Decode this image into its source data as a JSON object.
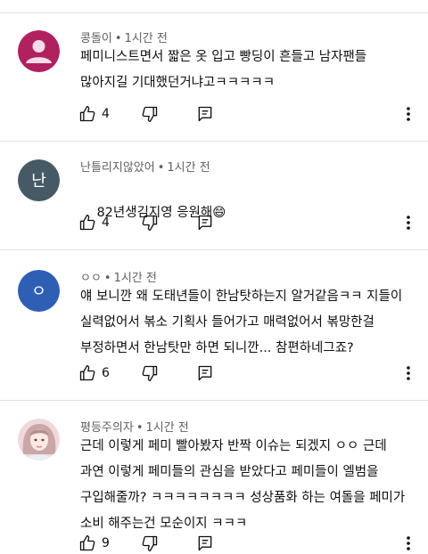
{
  "comments": [
    {
      "author": "콩돌이",
      "time": "1시간 전",
      "text": "페미니스트면서 짧은 옷 입고 빵딩이 흔들고 남자팬들 많아지길 기대했던거냐고ㅋㅋㅋㅋㅋ",
      "likes": "4",
      "avatar": {
        "kind": "default-person",
        "color": "#b1205f"
      }
    },
    {
      "author": "난틀리지않았어",
      "time": "1시간 전",
      "text": "82년생김지영 응원해",
      "emoji": "😄",
      "likes": "4",
      "avatar": {
        "kind": "letter",
        "letter": "난",
        "color": "#455a64"
      }
    },
    {
      "author": "ㅇㅇ",
      "time": "1시간 전",
      "text": "얘 보니깐 왜 도태년들이 한남탓하는지 알거같음ㅋㅋ 지들이 실력없어서 볶소 기획사 들어가고 매력없어서 볶망한걸 부정하면서 한남탓만 하면 되니깐... 참편하네그죠?",
      "likes": "6",
      "avatar": {
        "kind": "letter",
        "letter": "ㅇ",
        "color": "#2f5fb5"
      }
    },
    {
      "author": "평등주의자",
      "time": "1시간 전",
      "text": "근데 이렇게 페미 빨아봤자 반짝 이슈는 되겠지 ㅇㅇ 근데 과연 이렇게 페미들의 관심을 받았다고 페미들이 엘범을 구입해줄까? ㅋㅋㅋㅋㅋㅋㅋㅋ 성상품화 하는 여돌을 페미가 소비 해주는건 모순이지 ㅋㅋㅋ",
      "likes": "9",
      "avatar": {
        "kind": "photo",
        "color": "#f0d8dc"
      }
    }
  ],
  "separator": "•"
}
